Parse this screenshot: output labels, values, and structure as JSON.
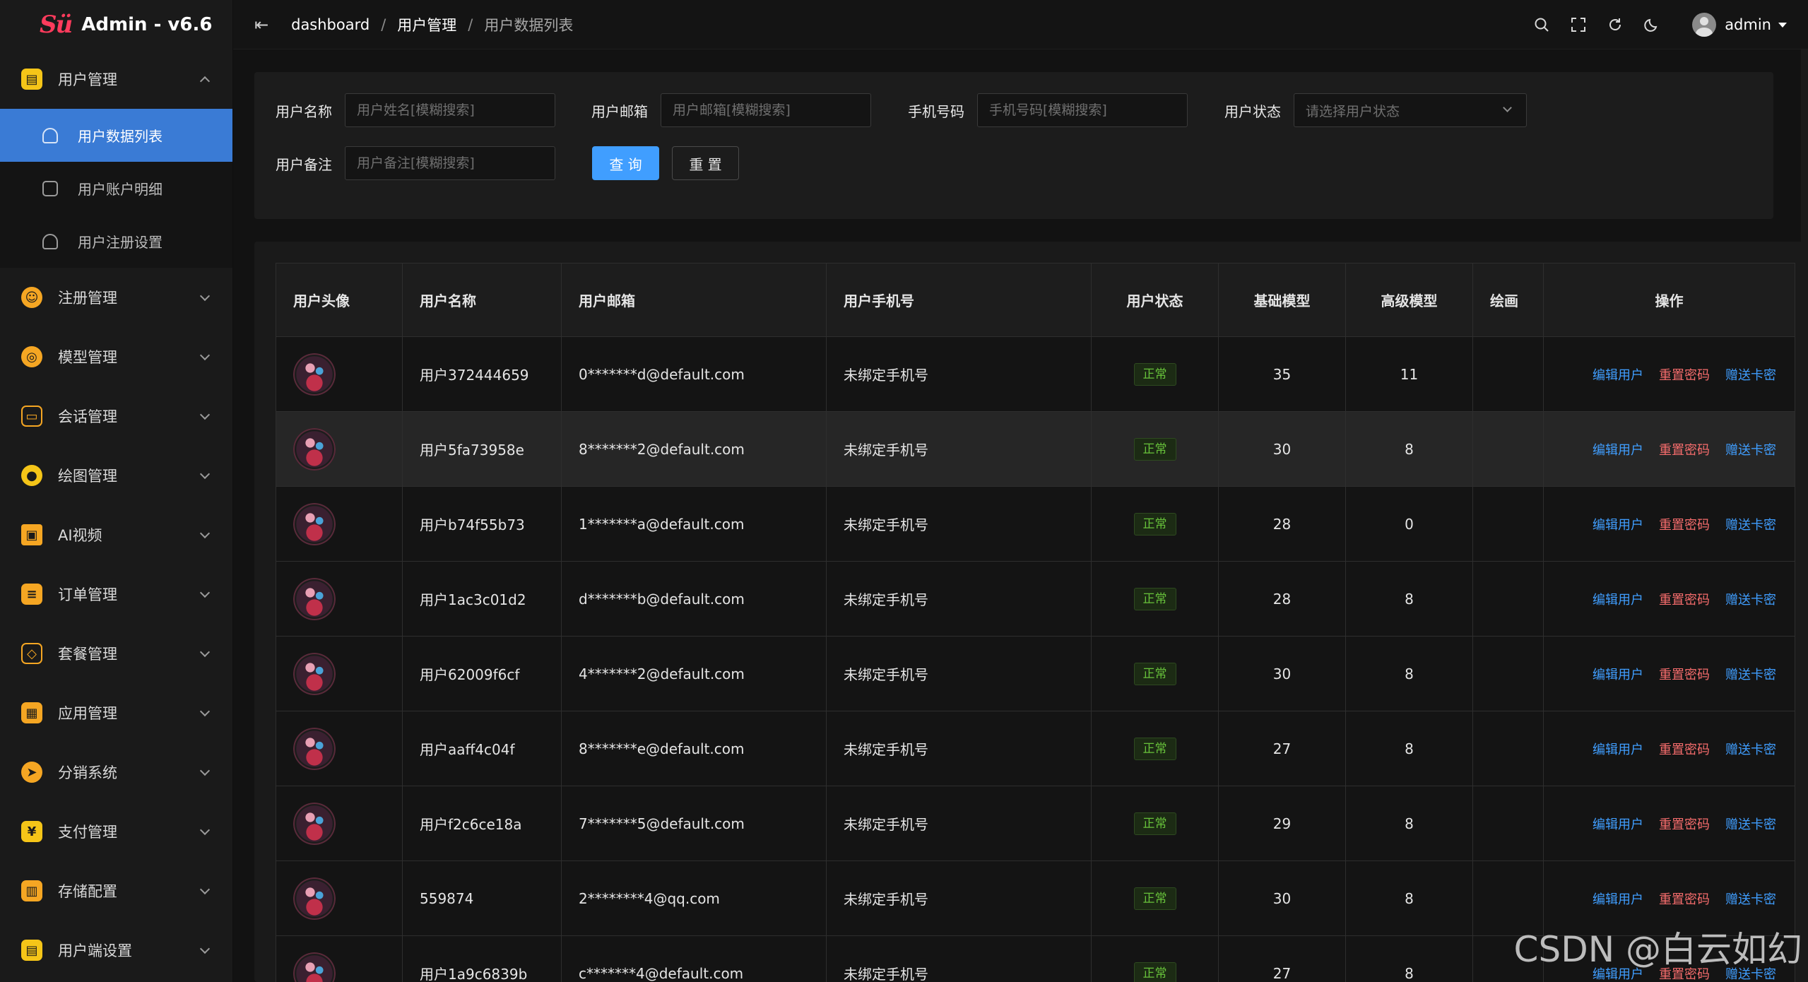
{
  "app": {
    "brand_mark": "Sü",
    "title": "Admin - v6.6"
  },
  "breadcrumb": [
    "dashboard",
    "用户管理",
    "用户数据列表"
  ],
  "header": {
    "username": "admin"
  },
  "sidebar": {
    "group_open": {
      "label": "用户管理",
      "children": [
        {
          "label": "用户数据列表",
          "active": true
        },
        {
          "label": "用户账户明细",
          "active": false
        },
        {
          "label": "用户注册设置",
          "active": false
        }
      ]
    },
    "items": [
      {
        "label": "注册管理",
        "icon": "register-icon",
        "color": "#f5a623"
      },
      {
        "label": "模型管理",
        "icon": "model-icon",
        "color": "#f5a623"
      },
      {
        "label": "会话管理",
        "icon": "chat-icon",
        "color": "#f5a623"
      },
      {
        "label": "绘图管理",
        "icon": "palette-icon",
        "color": "#f5c518"
      },
      {
        "label": "AI视频",
        "icon": "video-icon",
        "color": "#f5a623"
      },
      {
        "label": "订单管理",
        "icon": "order-icon",
        "color": "#f5a623"
      },
      {
        "label": "套餐管理",
        "icon": "package-icon",
        "color": "#f5a623"
      },
      {
        "label": "应用管理",
        "icon": "apps-icon",
        "color": "#f5a623"
      },
      {
        "label": "分销系统",
        "icon": "distribution-icon",
        "color": "#f5a623"
      },
      {
        "label": "支付管理",
        "icon": "payment-icon",
        "color": "#f5c518"
      },
      {
        "label": "存储配置",
        "icon": "storage-icon",
        "color": "#f5a623"
      },
      {
        "label": "用户端设置",
        "icon": "client-settings-icon",
        "color": "#f5c518"
      }
    ]
  },
  "search": {
    "name_label": "用户名称",
    "name_placeholder": "用户姓名[模糊搜索]",
    "email_label": "用户邮箱",
    "email_placeholder": "用户邮箱[模糊搜索]",
    "phone_label": "手机号码",
    "phone_placeholder": "手机号码[模糊搜索]",
    "status_label": "用户状态",
    "status_placeholder": "请选择用户状态",
    "remark_label": "用户备注",
    "remark_placeholder": "用户备注[模糊搜索]",
    "query_button": "查 询",
    "reset_button": "重 置"
  },
  "table": {
    "columns": [
      "用户头像",
      "用户名称",
      "用户邮箱",
      "用户手机号",
      "用户状态",
      "基础模型",
      "高级模型",
      "绘画",
      "操作"
    ],
    "actions": {
      "edit": "编辑用户",
      "reset_password": "重置密码",
      "gift_card": "赠送卡密"
    },
    "rows": [
      {
        "name": "用户372444659",
        "email": "0*******d@default.com",
        "phone": "未绑定手机号",
        "status": "正常",
        "basic": "35",
        "advanced": "11",
        "draw": ""
      },
      {
        "name": "用户5fa73958e",
        "email": "8*******2@default.com",
        "phone": "未绑定手机号",
        "status": "正常",
        "basic": "30",
        "advanced": "8",
        "draw": ""
      },
      {
        "name": "用户b74f55b73",
        "email": "1*******a@default.com",
        "phone": "未绑定手机号",
        "status": "正常",
        "basic": "28",
        "advanced": "0",
        "draw": ""
      },
      {
        "name": "用户1ac3c01d2",
        "email": "d*******b@default.com",
        "phone": "未绑定手机号",
        "status": "正常",
        "basic": "28",
        "advanced": "8",
        "draw": ""
      },
      {
        "name": "用户62009f6cf",
        "email": "4*******2@default.com",
        "phone": "未绑定手机号",
        "status": "正常",
        "basic": "30",
        "advanced": "8",
        "draw": ""
      },
      {
        "name": "用户aaff4c04f",
        "email": "8*******e@default.com",
        "phone": "未绑定手机号",
        "status": "正常",
        "basic": "27",
        "advanced": "8",
        "draw": ""
      },
      {
        "name": "用户f2c6ce18a",
        "email": "7*******5@default.com",
        "phone": "未绑定手机号",
        "status": "正常",
        "basic": "29",
        "advanced": "8",
        "draw": ""
      },
      {
        "name": "559874",
        "email": "2********4@qq.com",
        "phone": "未绑定手机号",
        "status": "正常",
        "basic": "30",
        "advanced": "8",
        "draw": ""
      },
      {
        "name": "用户1a9c6839b",
        "email": "c*******4@default.com",
        "phone": "未绑定手机号",
        "status": "正常",
        "basic": "27",
        "advanced": "8",
        "draw": ""
      }
    ]
  },
  "watermark": "CSDN @白云如幻",
  "colors": {
    "accent": "#409eff",
    "danger": "#f56c6c",
    "success": "#67c23a",
    "active_menu": "#3a7bd5"
  }
}
